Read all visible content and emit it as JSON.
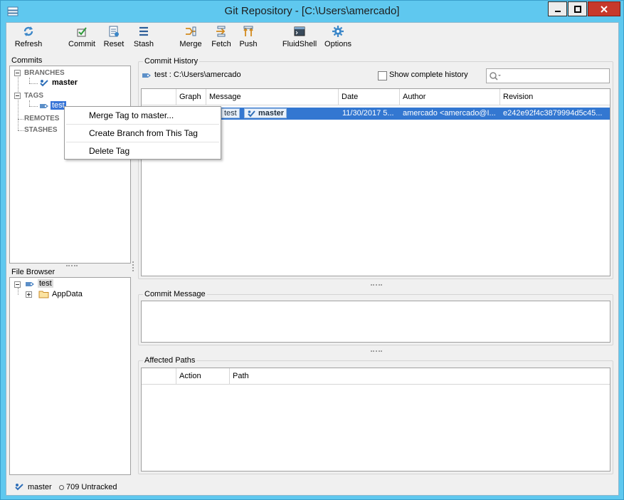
{
  "window": {
    "title": "Git Repository - [C:\\Users\\amercado]",
    "controls": [
      "minimize-button",
      "maximize-button",
      "close-button"
    ]
  },
  "toolbar": {
    "refresh": "Refresh",
    "commit": "Commit",
    "reset": "Reset",
    "stash": "Stash",
    "merge": "Merge",
    "fetch": "Fetch",
    "push": "Push",
    "fluidshell": "FluidShell",
    "options": "Options"
  },
  "commits_panel": {
    "title": "Commits",
    "branches_label": "BRANCHES",
    "branch_master": "master",
    "tags_label": "TAGS",
    "tag_test": "test",
    "remotes_label": "REMOTES",
    "stashes_label": "STASHES"
  },
  "context_menu": {
    "items": [
      "Merge Tag to master...",
      "Create Branch from This Tag",
      "Delete Tag"
    ]
  },
  "file_browser": {
    "title": "File Browser",
    "root": "test",
    "child": "AppData"
  },
  "commit_history": {
    "title": "Commit  History",
    "path_label": "test : C:\\Users\\amercado",
    "show_complete_history": "Show complete history",
    "columns": [
      "Graph",
      "Message",
      "Date",
      "Author",
      "Revision"
    ],
    "row": {
      "tag_chip": "test",
      "branch_chip": "master",
      "date": "11/30/2017 5...",
      "author": "amercado <amercado@I...",
      "revision": "e242e92f4c3879994d5c45..."
    }
  },
  "commit_message": {
    "title": "Commit Message"
  },
  "affected_paths": {
    "title": "Affected Paths",
    "columns": [
      "Action",
      "Path"
    ]
  },
  "statusbar": {
    "branch": "master",
    "untracked": "709 Untracked"
  },
  "colors": {
    "titlebar": "#5fc8ef",
    "selection": "#3377d1",
    "close_button": "#c7392b"
  }
}
